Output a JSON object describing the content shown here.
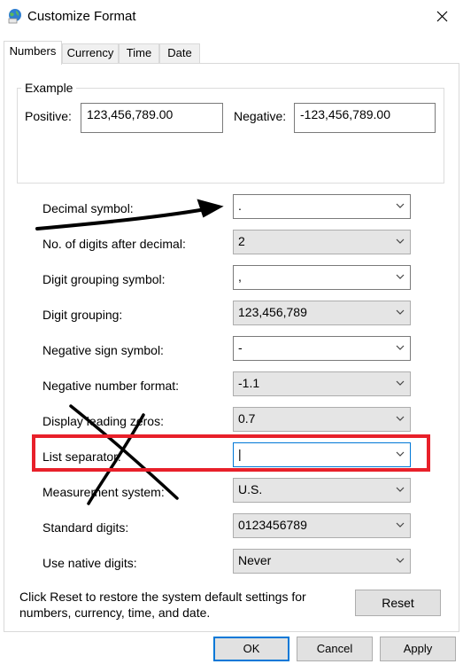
{
  "window": {
    "title": "Customize Format",
    "icon": "globe-settings-icon",
    "close_icon": "close-icon"
  },
  "tabs": [
    {
      "label": "Numbers",
      "active": true
    },
    {
      "label": "Currency",
      "active": false
    },
    {
      "label": "Time",
      "active": false
    },
    {
      "label": "Date",
      "active": false
    }
  ],
  "example": {
    "legend": "Example",
    "positive_label": "Positive:",
    "positive_value": "123,456,789.00",
    "negative_label": "Negative:",
    "negative_value": "-123,456,789.00"
  },
  "settings": [
    {
      "label": "Decimal symbol:",
      "value": ".",
      "editable": true
    },
    {
      "label": "No. of digits after decimal:",
      "value": "2",
      "editable": false
    },
    {
      "label": "Digit grouping symbol:",
      "value": ",",
      "editable": true
    },
    {
      "label": "Digit grouping:",
      "value": "123,456,789",
      "editable": false
    },
    {
      "label": "Negative sign symbol:",
      "value": "-",
      "editable": true
    },
    {
      "label": "Negative number format:",
      "value": "-1.1",
      "editable": false
    },
    {
      "label": "Display leading zeros:",
      "value": "0.7",
      "editable": false
    },
    {
      "label": "List separator:",
      "value": "|",
      "editable": true,
      "focused": true
    },
    {
      "label": "Measurement system:",
      "value": "U.S.",
      "editable": false
    },
    {
      "label": "Standard digits:",
      "value": "0123456789",
      "editable": false
    },
    {
      "label": "Use native digits:",
      "value": "Never",
      "editable": false
    }
  ],
  "footer": {
    "text": "Click Reset to restore the system default settings for numbers, currency, time, and date.",
    "reset_label": "Reset"
  },
  "buttons": {
    "ok": "OK",
    "cancel": "Cancel",
    "apply": "Apply"
  },
  "colors": {
    "accent": "#0078d7",
    "annotation_red": "#e8202a",
    "annotation_black": "#000000"
  }
}
